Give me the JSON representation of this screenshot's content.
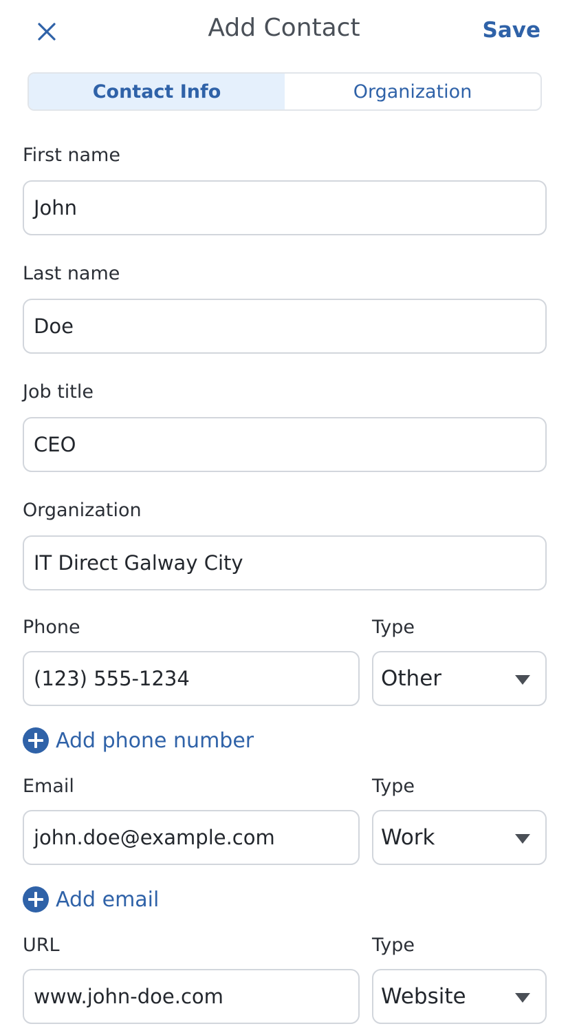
{
  "header": {
    "title": "Add Contact",
    "save_label": "Save"
  },
  "tabs": [
    {
      "label": "Contact Info",
      "active": true
    },
    {
      "label": "Organization",
      "active": false
    }
  ],
  "fields": {
    "first_name": {
      "label": "First name",
      "value": "John"
    },
    "last_name": {
      "label": "Last name",
      "value": "Doe"
    },
    "job_title": {
      "label": "Job title",
      "value": "CEO"
    },
    "organization": {
      "label": "Organization",
      "value": "IT Direct Galway City"
    },
    "phone": {
      "label": "Phone",
      "value": "(123) 555-1234",
      "type_label": "Type",
      "type_value": "Other"
    },
    "email": {
      "label": "Email",
      "value": "john.doe@example.com",
      "type_label": "Type",
      "type_value": "Work"
    },
    "url": {
      "label": "URL",
      "value": "www.john-doe.com",
      "type_label": "Type",
      "type_value": "Website"
    }
  },
  "actions": {
    "add_phone": "Add phone number",
    "add_email": "Add email"
  },
  "colors": {
    "accent": "#2f62a8",
    "active_tab_bg": "#e5f0fc",
    "border": "#d2d6dc"
  }
}
